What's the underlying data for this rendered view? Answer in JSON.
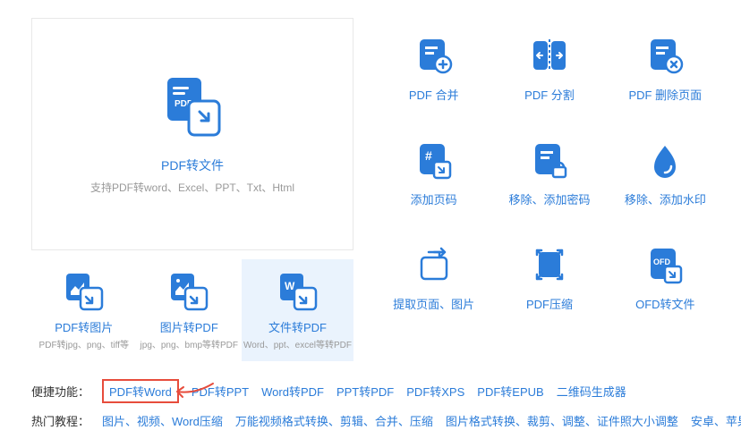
{
  "main_card": {
    "title": "PDF转文件",
    "subtitle": "支持PDF转word、Excel、PPT、Txt、Html"
  },
  "small_cards": [
    {
      "title": "PDF转图片",
      "sub": "PDF转jpg、png、tiff等"
    },
    {
      "title": "图片转PDF",
      "sub": "jpg、png、bmp等转PDF"
    },
    {
      "title": "文件转PDF",
      "sub": "Word、ppt、excel等转PDF"
    }
  ],
  "grid": [
    {
      "label": "PDF 合并"
    },
    {
      "label": "PDF 分割"
    },
    {
      "label": "PDF 删除页面"
    },
    {
      "label": "添加页码"
    },
    {
      "label": "移除、添加密码"
    },
    {
      "label": "移除、添加水印"
    },
    {
      "label": "提取页面、图片"
    },
    {
      "label": "PDF压缩"
    },
    {
      "label": "OFD转文件"
    }
  ],
  "shortcut": {
    "header": "便捷功能：",
    "links": [
      "PDF转Word",
      "PDF转PPT",
      "Word转PDF",
      "PPT转PDF",
      "PDF转XPS",
      "PDF转EPUB",
      "二维码生成器"
    ]
  },
  "tutorial": {
    "header": "热门教程：",
    "links": [
      "图片、视频、Word压缩",
      "万能视频格式转换、剪辑、合并、压缩",
      "图片格式转换、裁剪、调整、证件照大小调整",
      "安卓、苹果手机投屏到"
    ]
  }
}
